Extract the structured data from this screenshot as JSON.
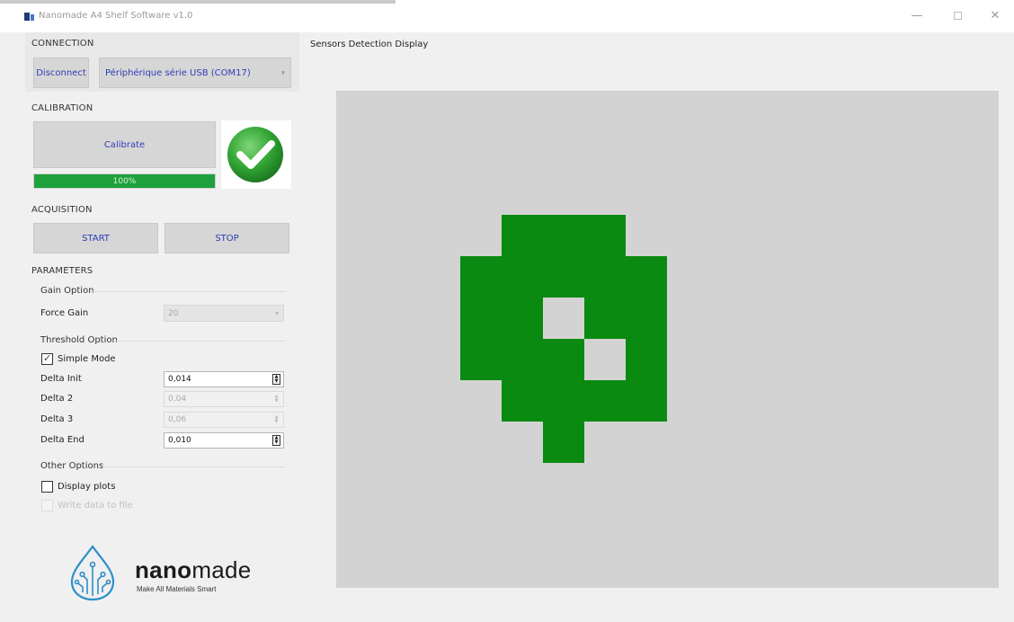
{
  "window": {
    "title": "Nanomade A4 Shelf Software v1.0",
    "minimize": "—",
    "close": "✕"
  },
  "connection": {
    "label": "CONNECTION",
    "disconnect_label": "Disconnect",
    "port_selected": "Périphérique série USB (COM17)"
  },
  "calibration": {
    "label": "CALIBRATION",
    "calibrate_label": "Calibrate",
    "progress_percent": 100,
    "progress_text": "100%",
    "status_icon": "check-circle-icon",
    "status_color": "#2eaa2e"
  },
  "acquisition": {
    "label": "ACQUISITION",
    "start_label": "START",
    "stop_label": "STOP"
  },
  "parameters": {
    "label": "PARAMETERS",
    "gain_group": "Gain Option",
    "force_gain_label": "Force Gain",
    "force_gain_value": "20",
    "threshold_group": "Threshold Option",
    "simple_mode_label": "Simple Mode",
    "simple_mode_checked": true,
    "delta_init_label": "Delta Init",
    "delta_init_value": "0,014",
    "delta_2_label": "Delta 2",
    "delta_2_value": "0,04",
    "delta_3_label": "Delta 3",
    "delta_3_value": "0,06",
    "delta_end_label": "Delta End",
    "delta_end_value": "0,010",
    "other_group": "Other Options",
    "display_plots_label": "Display plots",
    "display_plots_checked": false,
    "write_data_label": "Write data to file",
    "write_data_checked": false
  },
  "display": {
    "title": "Sensors Detection Display",
    "active_color": "#0a8a10",
    "background_color": "#d3d3d3"
  },
  "logo": {
    "word_bold": "nano",
    "word_rest": "made",
    "tagline": "Make All Materials Smart"
  }
}
